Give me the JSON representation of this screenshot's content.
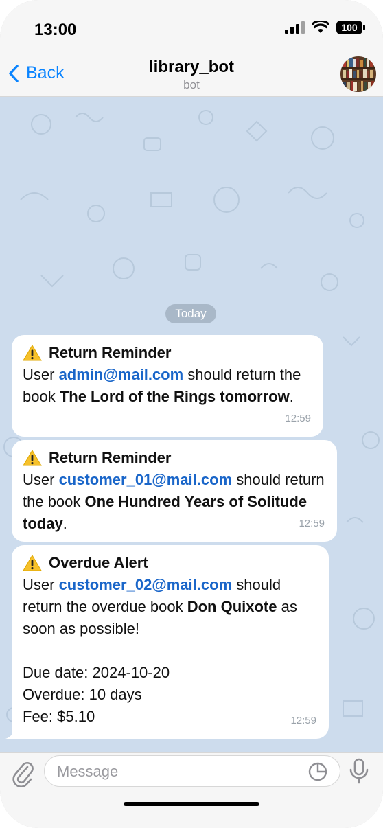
{
  "status_bar": {
    "time": "13:00",
    "battery": "100"
  },
  "header": {
    "back_label": "Back",
    "title": "library_bot",
    "subtitle": "bot"
  },
  "chat": {
    "date_chip": "Today",
    "messages": [
      {
        "heading": "Return Reminder",
        "prefix": "User ",
        "email": "admin@mail.com",
        "text1": " should return the book ",
        "book": "The Lord of the Rings tomorrow",
        "suffix": ".",
        "time": "12:59"
      },
      {
        "heading": "Return Reminder",
        "prefix": "User ",
        "email": "customer_01@mail.com",
        "text1": " should return the book ",
        "book": "One Hundred Years of Solitude today",
        "suffix": ".",
        "time": "12:59"
      },
      {
        "heading": "Overdue Alert",
        "prefix": "User ",
        "email": "customer_02@mail.com",
        "text1": " should return the overdue book ",
        "book": "Don Quixote",
        "suffix": " as soon as possible!",
        "due_date": "Due date: 2024-10-20",
        "overdue": "Overdue: 10 days",
        "fee": "Fee: $5.10",
        "time": "12:59"
      }
    ]
  },
  "composer": {
    "placeholder": "Message"
  },
  "icons": {
    "back": "chevron-left-icon",
    "warning": "warning-icon",
    "attach": "paperclip-icon",
    "sticker": "sticker-icon",
    "mic": "microphone-icon"
  },
  "colors": {
    "accent": "#0a84ff",
    "link": "#1a66c9",
    "chat_background": "#cddced",
    "date_chip": "#a9b8c8"
  }
}
